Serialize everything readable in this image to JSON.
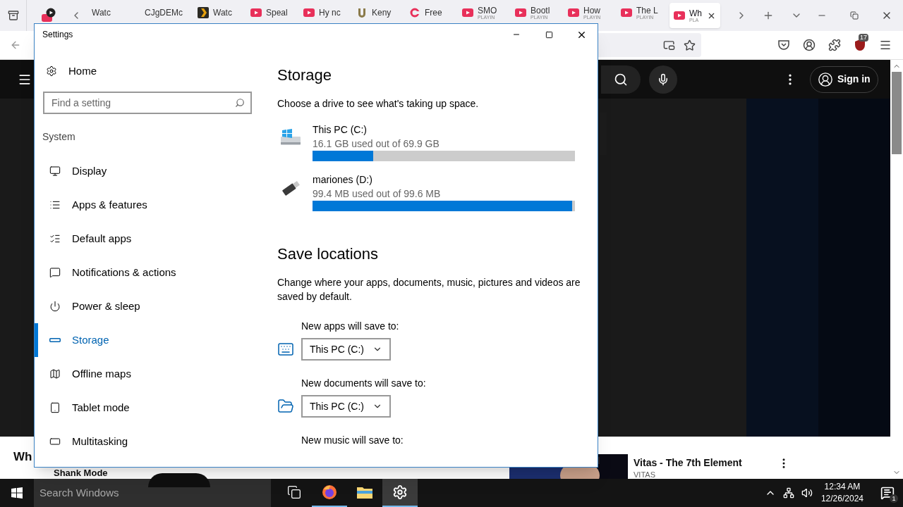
{
  "browser": {
    "tabs": [
      {
        "kind": "none",
        "title": "Watc",
        "selected": false
      },
      {
        "kind": "none",
        "title": "CJgDEMc",
        "selected": false
      },
      {
        "kind": "plex",
        "title": "Watc",
        "selected": false
      },
      {
        "kind": "youtube",
        "title": "Speal",
        "selected": false
      },
      {
        "kind": "youtube",
        "title": "Hy nc",
        "selected": false
      },
      {
        "kind": "u",
        "title": "Keny",
        "selected": false
      },
      {
        "kind": "cc",
        "title": "Free",
        "selected": false
      },
      {
        "kind": "youtube",
        "title": "SMO",
        "status": "PLAYIN",
        "selected": false
      },
      {
        "kind": "youtube",
        "title": "Bootl",
        "status": "PLAYIN",
        "selected": false
      },
      {
        "kind": "youtube",
        "title": "How",
        "status": "PLAYIN",
        "selected": false
      },
      {
        "kind": "youtube",
        "title": "The L",
        "status": "PLAYIN",
        "selected": false
      },
      {
        "kind": "youtube",
        "title": "Wh",
        "status": "PLA",
        "selected": true
      }
    ],
    "extension_badge": "17"
  },
  "youtube": {
    "sign_in": "Sign in",
    "below_title": "Wh",
    "channel": "Shank Mode",
    "recommendation": {
      "title": "Vitas - The 7th Element",
      "channel": "VITAS"
    }
  },
  "settings": {
    "title": "Settings",
    "home": "Home",
    "search": {
      "placeholder": "Find a setting"
    },
    "section": "System",
    "nav": [
      {
        "kind": "display",
        "label": "Display",
        "selected": false
      },
      {
        "kind": "apps",
        "label": "Apps & features",
        "selected": false
      },
      {
        "kind": "default",
        "label": "Default apps",
        "selected": false
      },
      {
        "kind": "notifications",
        "label": "Notifications & actions",
        "selected": false
      },
      {
        "kind": "power",
        "label": "Power & sleep",
        "selected": false
      },
      {
        "kind": "storage",
        "label": "Storage",
        "selected": true
      },
      {
        "kind": "maps",
        "label": "Offline maps",
        "selected": false
      },
      {
        "kind": "tablet",
        "label": "Tablet mode",
        "selected": false
      },
      {
        "kind": "multitasking",
        "label": "Multitasking",
        "selected": false
      }
    ],
    "heading": "Storage",
    "intro": "Choose a drive to see what's taking up space.",
    "drives": [
      {
        "kind": "pc",
        "name": "This PC (C:)",
        "usage": "16.1 GB used out of 69.9 GB",
        "level": 0.23
      },
      {
        "kind": "usb",
        "name": "mariones (D:)",
        "usage": "99.4 MB used out of 99.6 MB",
        "level": 0.99
      }
    ],
    "save_heading": "Save locations",
    "save_intro": "Change where your apps, documents, music, pictures and videos are saved by default.",
    "save_locations": [
      {
        "kind": "apps",
        "label": "New apps will save to:",
        "value": "This PC (C:)"
      },
      {
        "kind": "documents",
        "label": "New documents will save to:",
        "value": "This PC (C:)"
      },
      {
        "label": "New music will save to:"
      }
    ]
  },
  "taskbar": {
    "search_placeholder": "Search Windows",
    "apps": [
      {
        "kind": "taskview",
        "running": false,
        "selected": false
      },
      {
        "kind": "firefox",
        "running": true,
        "selected": false
      },
      {
        "kind": "explorer",
        "running": false,
        "selected": false
      },
      {
        "kind": "settings",
        "running": true,
        "selected": true
      }
    ],
    "time": "12:34 AM",
    "date": "12/26/2024",
    "notification_count": "1"
  }
}
